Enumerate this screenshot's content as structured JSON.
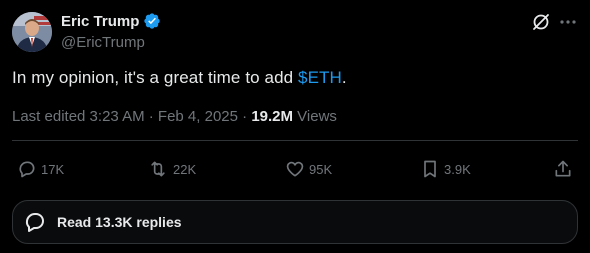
{
  "author": {
    "display_name": "Eric Trump",
    "handle": "@EricTrump",
    "verified": true,
    "avatar_icon": "profile-photo",
    "verified_color": "#1d9bf0"
  },
  "header_actions": [
    {
      "icon": "grok-icon"
    },
    {
      "icon": "more-icon"
    }
  ],
  "tweet": {
    "text_prefix": "In my opinion, it's a great time to add ",
    "cashtag": "$ETH",
    "text_suffix": ".",
    "cashtag_color": "#1d9bf0"
  },
  "meta": {
    "edited": "Last edited 3:23 AM · Feb 4, 2025 · ",
    "views_count": "19.2M",
    "views_label": " Views"
  },
  "actions": {
    "reply": {
      "icon": "reply-icon",
      "count": "17K"
    },
    "retweet": {
      "icon": "retweet-icon",
      "count": "22K"
    },
    "like": {
      "icon": "heart-icon",
      "count": "95K"
    },
    "bookmark": {
      "icon": "bookmark-icon",
      "count": "3.9K"
    },
    "share": {
      "icon": "share-icon"
    }
  },
  "replies_bar": {
    "icon": "chat-bubble-icon",
    "label": "Read 13.3K replies"
  }
}
